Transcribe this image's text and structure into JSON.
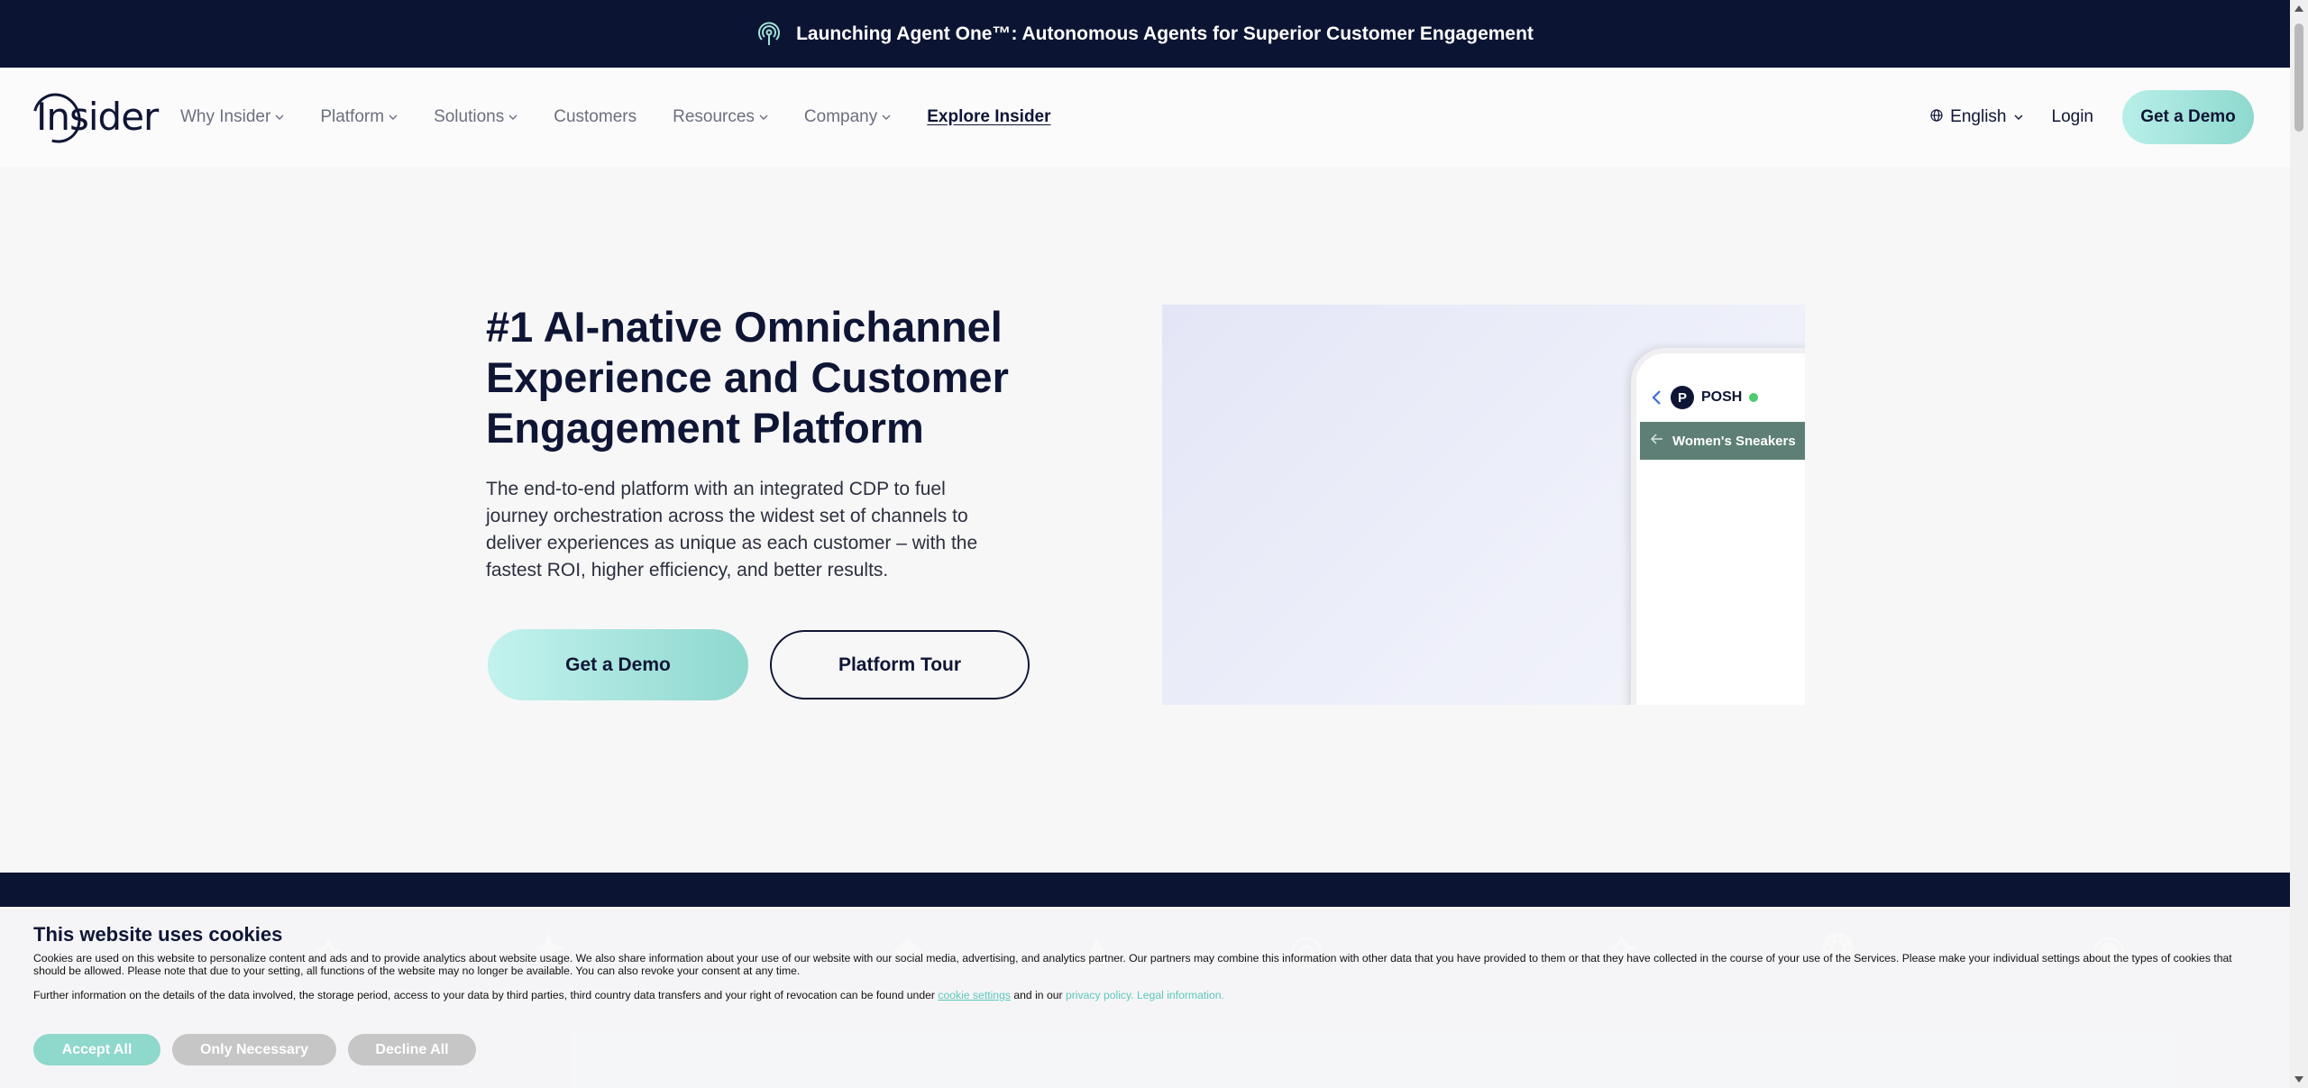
{
  "announcement": {
    "text": "Launching Agent One™: Autonomous Agents for Superior Customer Engagement",
    "icon": "broadcast-icon"
  },
  "header": {
    "logo_text": "Insider",
    "nav": [
      {
        "label": "Why Insider",
        "has_dropdown": true
      },
      {
        "label": "Platform",
        "has_dropdown": true
      },
      {
        "label": "Solutions",
        "has_dropdown": true
      },
      {
        "label": "Customers",
        "has_dropdown": false
      },
      {
        "label": "Resources",
        "has_dropdown": true
      },
      {
        "label": "Company",
        "has_dropdown": true
      },
      {
        "label": "Explore Insider",
        "has_dropdown": false
      }
    ],
    "language": "English",
    "login": "Login",
    "cta": "Get a Demo"
  },
  "hero": {
    "title": "#1 AI-native Omnichannel Experience and Customer Engagement Platform",
    "description": "The end-to-end platform with an integrated CDP to fuel journey orchestration across the widest set of channels to deliver experiences as unique as each customer – with the fastest ROI, higher efficiency, and better results.",
    "primary_cta": "Get a Demo",
    "secondary_cta": "Platform Tour",
    "phone": {
      "badge": "P",
      "brand": "POSH",
      "category": "Women's Sneakers"
    }
  },
  "cookie": {
    "title": "This website uses cookies",
    "body": "Cookies are used on this website to personalize content and ads and to provide analytics about website usage. We also share information about your use of our website with our social media, advertising, and analytics partner. Our partners may combine this information with other data that you have provided to them or that they have collected in the course of your use of the Services. Please make your individual settings about the types of cookies that should be allowed. Please note that due to your setting, all functions of the website may no longer be available. You can also revoke your consent at any time.",
    "more_prefix": "Further information on the details of the data involved, the storage period, access to your data by third parties, third country data transfers and your right of revocation can be found under",
    "cookie_settings_link": "cookie settings",
    "more_mid": "and in our",
    "privacy_link": "privacy policy.",
    "legal_link": "Legal information.",
    "accept": "Accept All",
    "necessary": "Only Necessary",
    "decline": "Decline All"
  },
  "colors": {
    "navy": "#0c1433",
    "teal": "#8ed8cc",
    "text": "#0f1535"
  }
}
